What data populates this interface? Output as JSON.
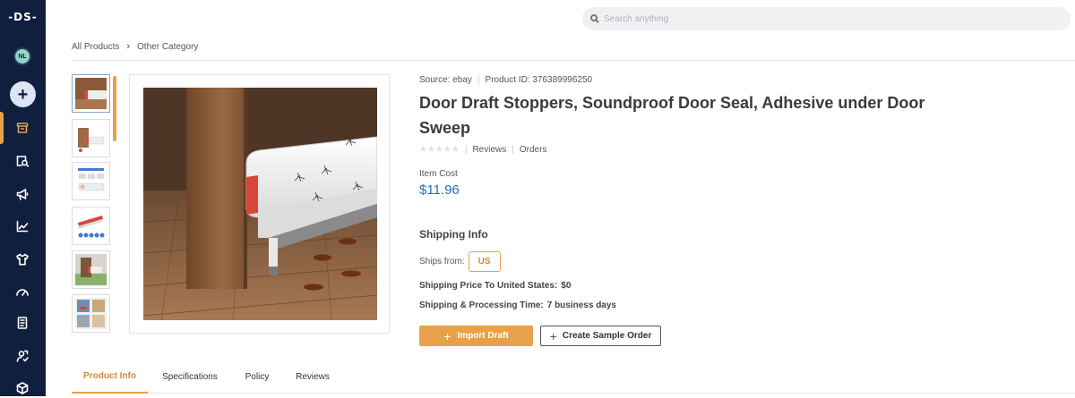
{
  "app": {
    "logo": "-DS-",
    "user_initials": "NL"
  },
  "sidebar": {
    "add_label": "+",
    "items": [
      {
        "name": "store-icon",
        "active": true
      },
      {
        "name": "product-search-icon",
        "active": false
      },
      {
        "name": "megaphone-icon",
        "active": false
      },
      {
        "name": "chart-line-icon",
        "active": false
      },
      {
        "name": "tshirt-icon",
        "active": false
      },
      {
        "name": "gauge-icon",
        "active": false
      },
      {
        "name": "document-icon",
        "active": false
      },
      {
        "name": "user-support-icon",
        "active": false
      },
      {
        "name": "box-icon",
        "active": false
      }
    ]
  },
  "search": {
    "placeholder": "Search anything"
  },
  "breadcrumb": {
    "items": [
      "All Products",
      "Other Category"
    ]
  },
  "product": {
    "source_label": "Source: ebay",
    "product_id_label": "Product ID: 376389996250",
    "title": "Door Draft Stoppers, Soundproof Door Seal, Adhesive under Door Sweep",
    "rating_stars": 0,
    "reviews_link": "Reviews",
    "orders_link": "Orders",
    "item_cost_label": "Item Cost",
    "item_cost": "$11.96"
  },
  "shipping": {
    "heading": "Shipping Info",
    "ships_from_label": "Ships from:",
    "ships_from_value": "US",
    "price_label": "Shipping Price To United States:",
    "price_value": "$0",
    "time_label": "Shipping & Processing Time:",
    "time_value": "7 business days"
  },
  "actions": {
    "import_label": "Import Draft",
    "sample_label": "Create Sample Order"
  },
  "tabs": [
    {
      "label": "Product Info",
      "active": true
    },
    {
      "label": "Specifications",
      "active": false
    },
    {
      "label": "Policy",
      "active": false
    },
    {
      "label": "Reviews",
      "active": false
    }
  ],
  "colors": {
    "sidebar": "#0f1f3d",
    "accent": "#e8a04a",
    "price": "#2869c4"
  }
}
